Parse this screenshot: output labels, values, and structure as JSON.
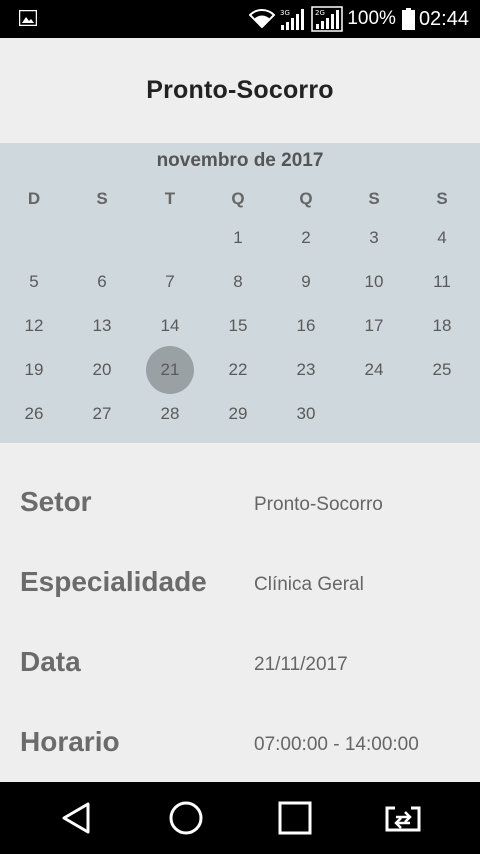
{
  "status_bar": {
    "notification_icon": "image-icon",
    "network_3g": "3G",
    "network_2g": "2G",
    "battery_percent": "100%",
    "time": "02:44"
  },
  "header": {
    "title": "Pronto-Socorro"
  },
  "calendar": {
    "month_label": "novembro de 2017",
    "weekdays": [
      "D",
      "S",
      "T",
      "Q",
      "Q",
      "S",
      "S"
    ],
    "weeks": [
      [
        "",
        "",
        "",
        "1",
        "2",
        "3",
        "4"
      ],
      [
        "5",
        "6",
        "7",
        "8",
        "9",
        "10",
        "11"
      ],
      [
        "12",
        "13",
        "14",
        "15",
        "16",
        "17",
        "18"
      ],
      [
        "19",
        "20",
        "21",
        "22",
        "23",
        "24",
        "25"
      ],
      [
        "26",
        "27",
        "28",
        "29",
        "30",
        "",
        ""
      ]
    ],
    "selected_day": "21"
  },
  "details": [
    {
      "label": "Setor",
      "value": "Pronto-Socorro"
    },
    {
      "label": "Especialidade",
      "value": "Clínica Geral"
    },
    {
      "label": "Data",
      "value": "21/11/2017"
    },
    {
      "label": "Horario",
      "value": "07:00:00 - 14:00:00"
    }
  ],
  "nav_bar": {
    "back": "back-icon",
    "home": "home-icon",
    "recents": "recents-icon",
    "switch": "switch-app-icon"
  }
}
